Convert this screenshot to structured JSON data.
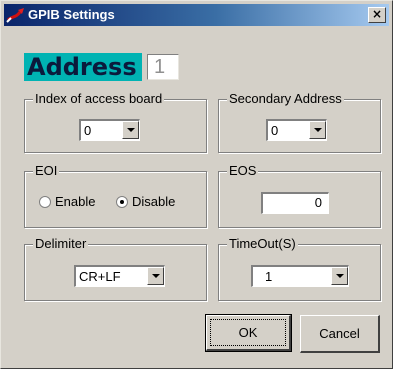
{
  "window": {
    "title": "GPIB Settings",
    "close_label": "×"
  },
  "address": {
    "label": "Address",
    "value": "1"
  },
  "index_of_access_board": {
    "label": "Index of access board",
    "value": "0"
  },
  "secondary_address": {
    "label": "Secondary Address",
    "value": "0"
  },
  "eoi": {
    "label": "EOI",
    "options": [
      {
        "label": "Enable",
        "selected": false
      },
      {
        "label": "Disable",
        "selected": true
      }
    ]
  },
  "eos": {
    "label": "EOS",
    "value": "0"
  },
  "delimiter": {
    "label": "Delimiter",
    "value": "CR+LF"
  },
  "timeout": {
    "label": "TimeOut(S)",
    "value": "1"
  },
  "buttons": {
    "ok": "OK",
    "cancel": "Cancel"
  },
  "icons": {
    "title": "gpib-cable-icon",
    "dropdown": "chevron-down-icon"
  },
  "colors": {
    "address_highlight": "#00b3b3",
    "titlebar_start": "#0a246a",
    "titlebar_end": "#a6caf0"
  }
}
